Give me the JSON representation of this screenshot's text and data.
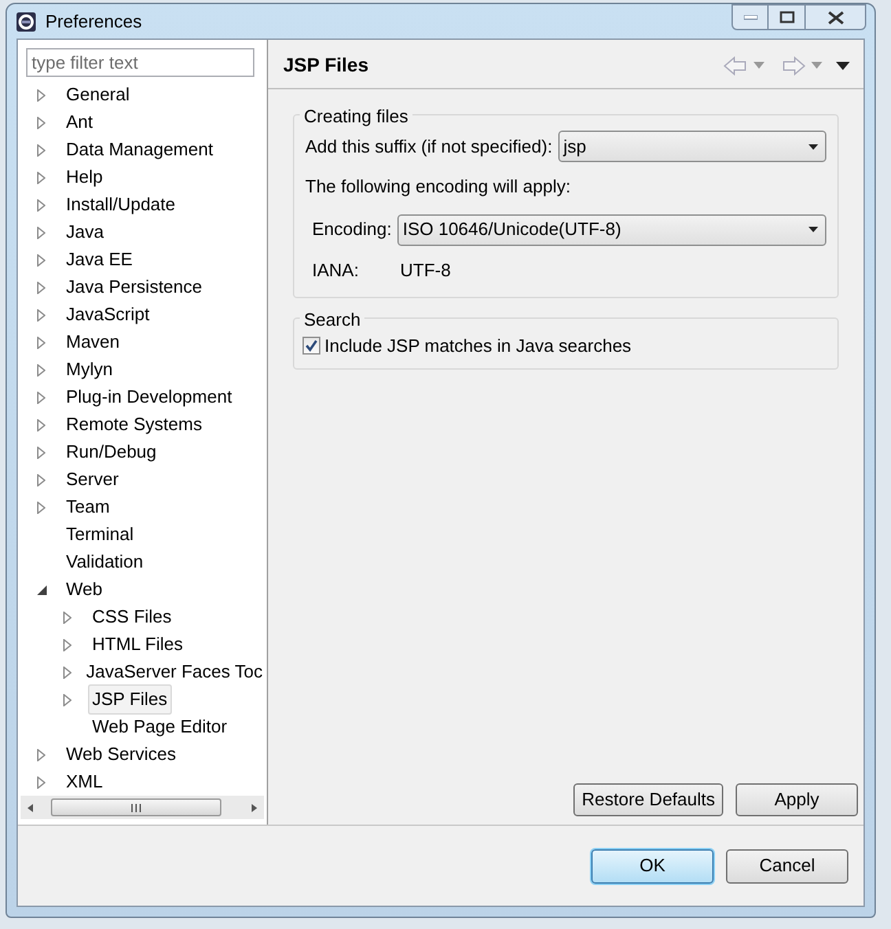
{
  "window": {
    "title": "Preferences"
  },
  "filter": {
    "placeholder": "type filter text"
  },
  "tree": [
    {
      "label": "General",
      "expandable": true,
      "selected": false
    },
    {
      "label": "Ant",
      "expandable": true,
      "selected": false
    },
    {
      "label": "Data Management",
      "expandable": true,
      "selected": false
    },
    {
      "label": "Help",
      "expandable": true,
      "selected": false
    },
    {
      "label": "Install/Update",
      "expandable": true,
      "selected": false
    },
    {
      "label": "Java",
      "expandable": true,
      "selected": false
    },
    {
      "label": "Java EE",
      "expandable": true,
      "selected": false
    },
    {
      "label": "Java Persistence",
      "expandable": true,
      "selected": false
    },
    {
      "label": "JavaScript",
      "expandable": true,
      "selected": false
    },
    {
      "label": "Maven",
      "expandable": true,
      "selected": false
    },
    {
      "label": "Mylyn",
      "expandable": true,
      "selected": false
    },
    {
      "label": "Plug-in Development",
      "expandable": true,
      "selected": false
    },
    {
      "label": "Remote Systems",
      "expandable": true,
      "selected": false
    },
    {
      "label": "Run/Debug",
      "expandable": true,
      "selected": false
    },
    {
      "label": "Server",
      "expandable": true,
      "selected": false
    },
    {
      "label": "Team",
      "expandable": true,
      "selected": false
    },
    {
      "label": "Terminal",
      "expandable": false,
      "selected": false
    },
    {
      "label": "Validation",
      "expandable": false,
      "selected": false
    },
    {
      "label": "Web",
      "expandable": true,
      "expanded": true,
      "selected": false,
      "children": [
        {
          "label": "CSS Files",
          "expandable": true,
          "selected": false
        },
        {
          "label": "HTML Files",
          "expandable": true,
          "selected": false
        },
        {
          "label": "JavaServer Faces Toc",
          "expandable": true,
          "selected": false
        },
        {
          "label": "JSP Files",
          "expandable": true,
          "selected": true
        },
        {
          "label": "Web Page Editor",
          "expandable": false,
          "selected": false
        }
      ]
    },
    {
      "label": "Web Services",
      "expandable": true,
      "selected": false
    },
    {
      "label": "XML",
      "expandable": true,
      "selected": false
    }
  ],
  "page": {
    "title": "JSP Files",
    "creating_files": {
      "title": "Creating files",
      "suffix_label": "Add this suffix (if not specified):",
      "suffix_value": "jsp",
      "encoding_note": "The following encoding will apply:",
      "encoding_label": "Encoding:",
      "encoding_value": "ISO 10646/Unicode(UTF-8)",
      "iana_label": "IANA:",
      "iana_value": "UTF-8"
    },
    "search": {
      "title": "Search",
      "include_label": "Include JSP matches in Java searches",
      "checked": true
    },
    "buttons": [
      "Restore Defaults",
      "Apply"
    ]
  },
  "dialog_buttons": [
    {
      "label": "OK",
      "default": true
    },
    {
      "label": "Cancel",
      "default": false
    }
  ]
}
